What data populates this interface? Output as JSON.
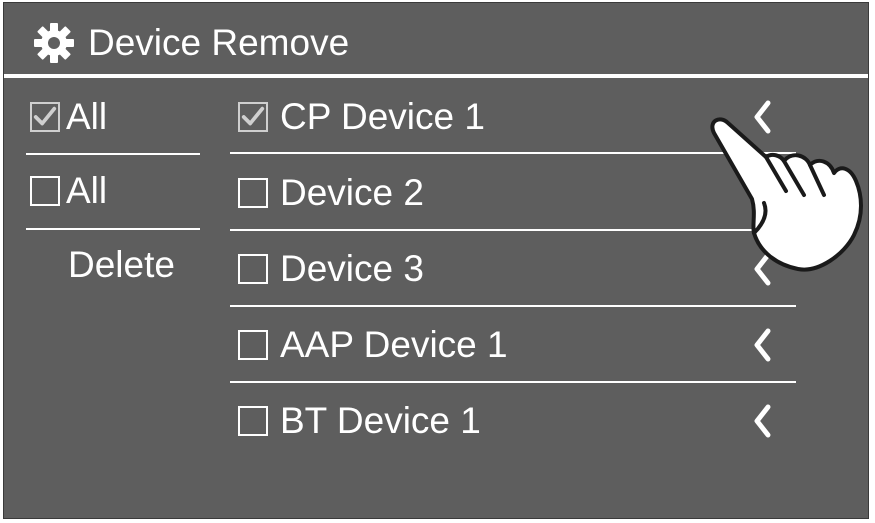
{
  "header": {
    "title": "Device Remove",
    "icon": "gear-icon"
  },
  "sidebar": {
    "select_all": {
      "label": "All",
      "checked": true
    },
    "deselect_all": {
      "label": "All",
      "checked": false
    },
    "delete_label": "Delete"
  },
  "devices": [
    {
      "name": "CP Device 1",
      "checked": true
    },
    {
      "name": "Device 2",
      "checked": false
    },
    {
      "name": "Device 3",
      "checked": false
    },
    {
      "name": "AAP Device 1",
      "checked": false
    },
    {
      "name": "BT Device 1",
      "checked": false
    }
  ],
  "colors": {
    "background": "#5e5e5e",
    "text": "#ffffff",
    "check_mark": "#cfcfcf"
  }
}
